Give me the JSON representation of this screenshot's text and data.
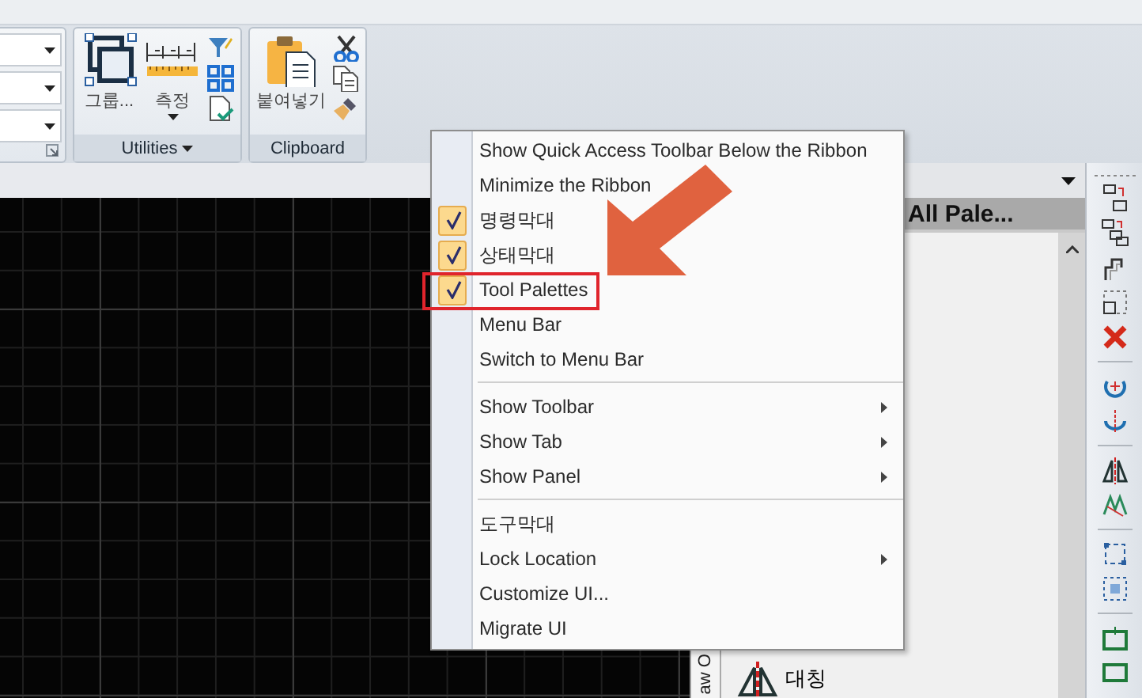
{
  "ribbon": {
    "panels": [
      {
        "kind": "utilities",
        "title": "Utilities",
        "has_menu": true,
        "tools": [
          {
            "label": "그룹...",
            "dropdown": false
          },
          {
            "label": "측정",
            "dropdown": true
          }
        ]
      },
      {
        "kind": "clipboard",
        "title": "Clipboard",
        "has_menu": false,
        "tools": [
          {
            "label": "붙여넣기",
            "dropdown": false
          }
        ]
      }
    ]
  },
  "palette": {
    "side_tab": "aw O",
    "tab": "All Pale...",
    "items": [
      {
        "label": "대칭"
      }
    ]
  },
  "context_menu": {
    "items": [
      {
        "kind": "command",
        "label": "Show Quick Access Toolbar Below the Ribbon",
        "checked": false,
        "submenu": false,
        "outlined": false
      },
      {
        "kind": "command",
        "label": "Minimize the Ribbon",
        "checked": false,
        "submenu": false,
        "outlined": false
      },
      {
        "kind": "command",
        "label": "명령막대",
        "checked": true,
        "submenu": false,
        "outlined": false
      },
      {
        "kind": "command",
        "label": "상태막대",
        "checked": true,
        "submenu": false,
        "outlined": false
      },
      {
        "kind": "command",
        "label": "Tool Palettes",
        "checked": true,
        "submenu": false,
        "outlined": true
      },
      {
        "kind": "command",
        "label": "Menu Bar",
        "checked": false,
        "submenu": false,
        "outlined": false
      },
      {
        "kind": "command",
        "label": "Switch to Menu Bar",
        "checked": false,
        "submenu": false,
        "outlined": false
      },
      {
        "kind": "separator"
      },
      {
        "kind": "command",
        "label": "Show Toolbar",
        "checked": false,
        "submenu": true,
        "outlined": false
      },
      {
        "kind": "command",
        "label": "Show Tab",
        "checked": false,
        "submenu": true,
        "outlined": false
      },
      {
        "kind": "command",
        "label": "Show Panel",
        "checked": false,
        "submenu": true,
        "outlined": false
      },
      {
        "kind": "separator"
      },
      {
        "kind": "command",
        "label": "도구막대",
        "checked": false,
        "submenu": false,
        "outlined": false
      },
      {
        "kind": "command",
        "label": "Lock Location",
        "checked": false,
        "submenu": true,
        "outlined": false
      },
      {
        "kind": "command",
        "label": "Customize UI...",
        "checked": false,
        "submenu": false,
        "outlined": false
      },
      {
        "kind": "command",
        "label": "Migrate UI",
        "checked": false,
        "submenu": false,
        "outlined": false
      }
    ]
  }
}
